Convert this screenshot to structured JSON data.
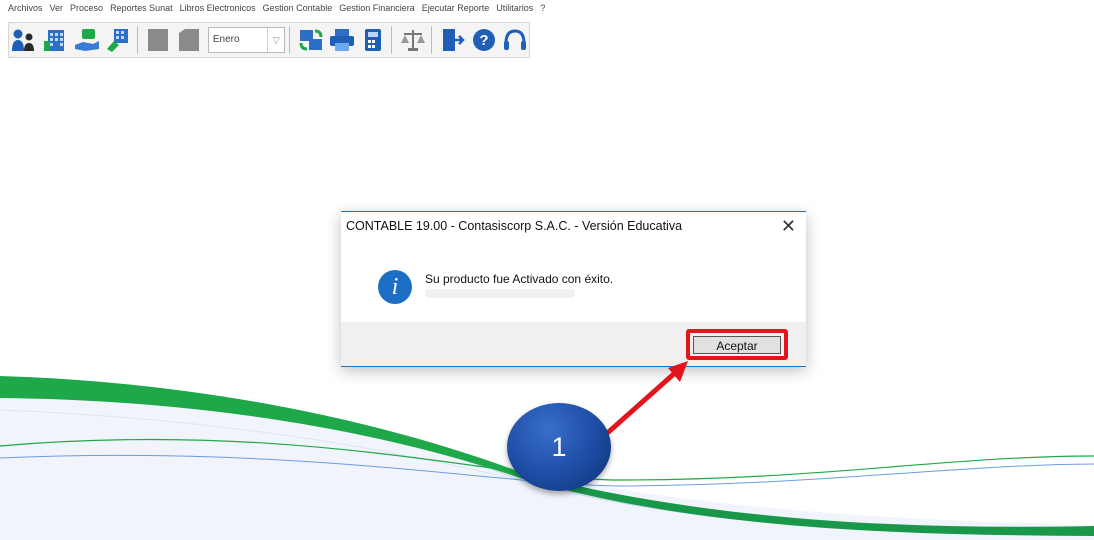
{
  "menubar": {
    "items": [
      "Archivos",
      "Ver",
      "Proceso",
      "Reportes Sunat",
      "Libros Electronicos",
      "Gestion Contable",
      "Gestion Financiera",
      "Ejecutar Reporte",
      "Utilitarios",
      "?"
    ]
  },
  "toolbar": {
    "month_value": "Enero",
    "icons": [
      "users-icon",
      "building-icon",
      "hand-money-icon",
      "clipboard-icon",
      "doc-gray-icon",
      "doc-gray-icon-2",
      "sync-icon",
      "printer-icon",
      "calculator-icon",
      "balance-icon",
      "exit-door-icon",
      "help-icon",
      "headset-icon"
    ]
  },
  "dialog": {
    "title": "CONTABLE 19.00 - Contasiscorp S.A.C.  - Versión Educativa",
    "close_glyph": "✕",
    "message": "Su producto fue Activado con éxito.",
    "button_label": "Aceptar",
    "icon": "info-icon"
  },
  "callout": {
    "step_number": "1",
    "highlight_color": "#e3151c"
  },
  "colors": {
    "accent_blue": "#1a73c9",
    "wave_green": "#1fa84a",
    "badge_blue": "#1e4fa8"
  }
}
